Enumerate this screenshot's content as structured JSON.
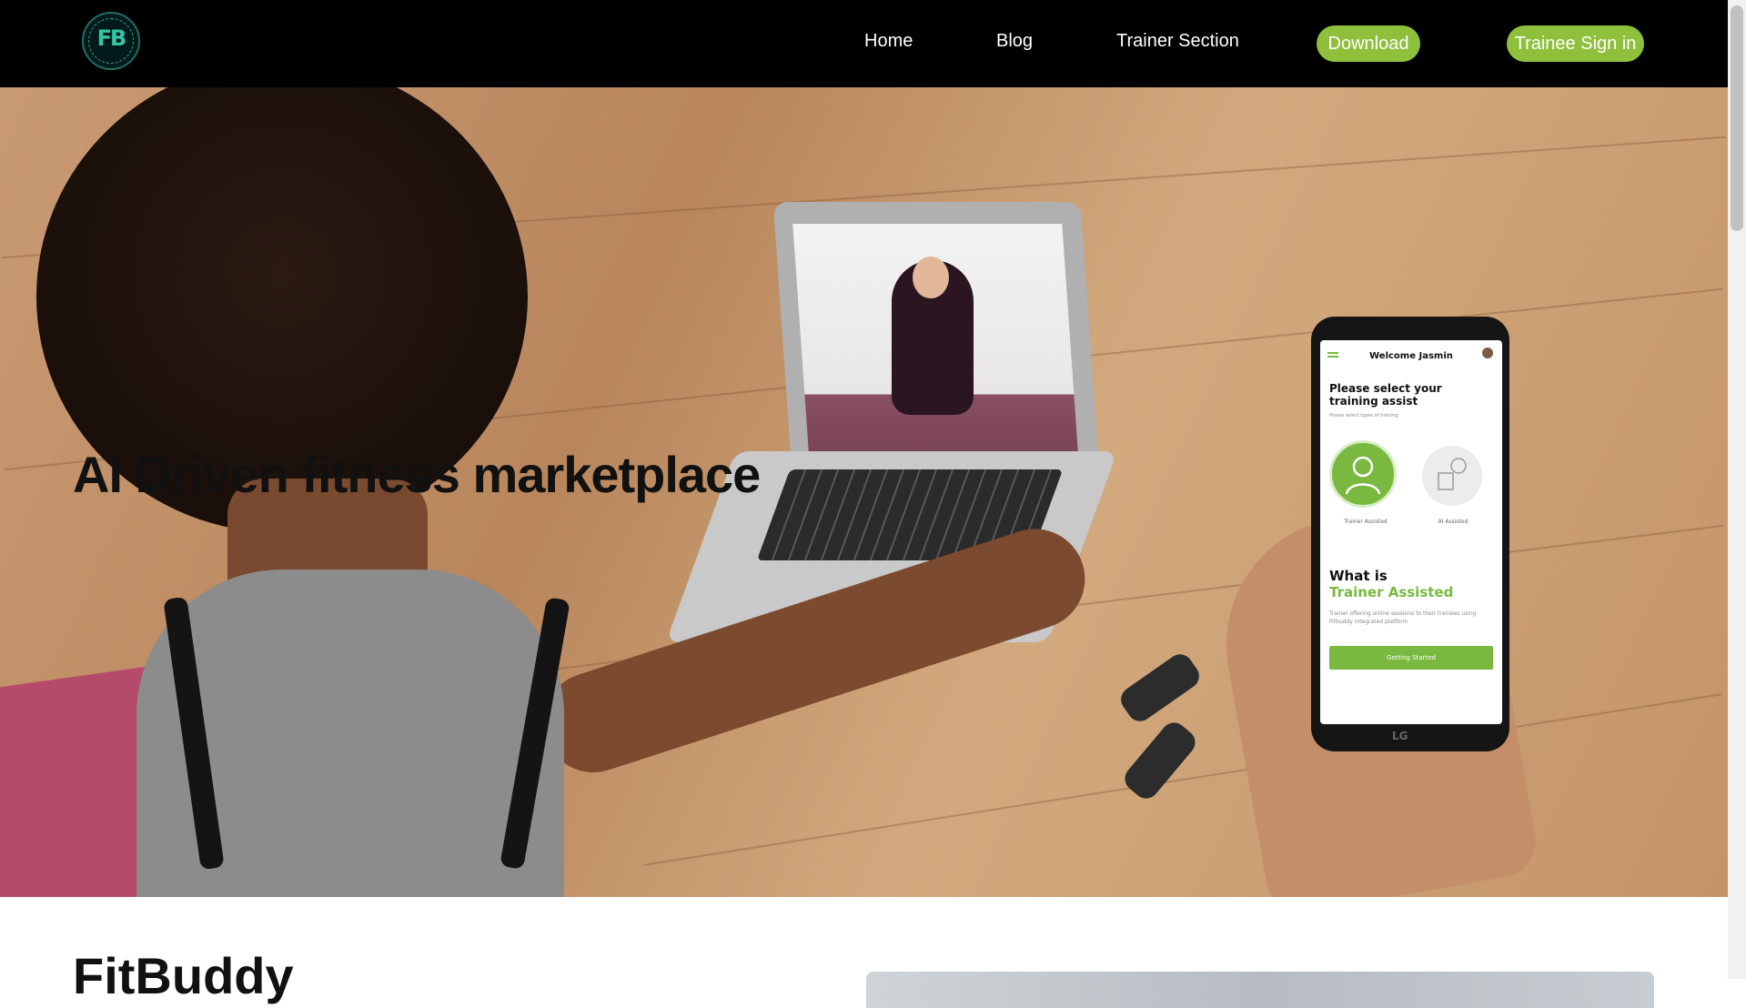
{
  "header": {
    "logo_icon": "fitbuddy-logo-icon",
    "logo_text": "FB",
    "nav": {
      "home": "Home",
      "blog": "Blog",
      "trainer_section": "Trainer Section"
    },
    "buttons": {
      "download": "Download",
      "trainee_sign_in": "Trainee Sign in"
    },
    "accent_color": "#8fc03c",
    "background_color": "#000000"
  },
  "hero": {
    "title": "AI Driven fitness marketplace",
    "phone": {
      "welcome": "Welcome Jasmin",
      "heading": "Please select your training assist",
      "subtext": "Please select types of training",
      "option_1": "Trainer Assisted",
      "option_2": "AI Assisted",
      "what_is": "What is",
      "what_is_highlight": "Trainer Assisted",
      "description": "Trainer offering online sessions to their trainees using Fitbuddy integrated platform",
      "cta": "Getting Started",
      "brand": "LG"
    }
  },
  "section": {
    "title": "FitBuddy"
  }
}
